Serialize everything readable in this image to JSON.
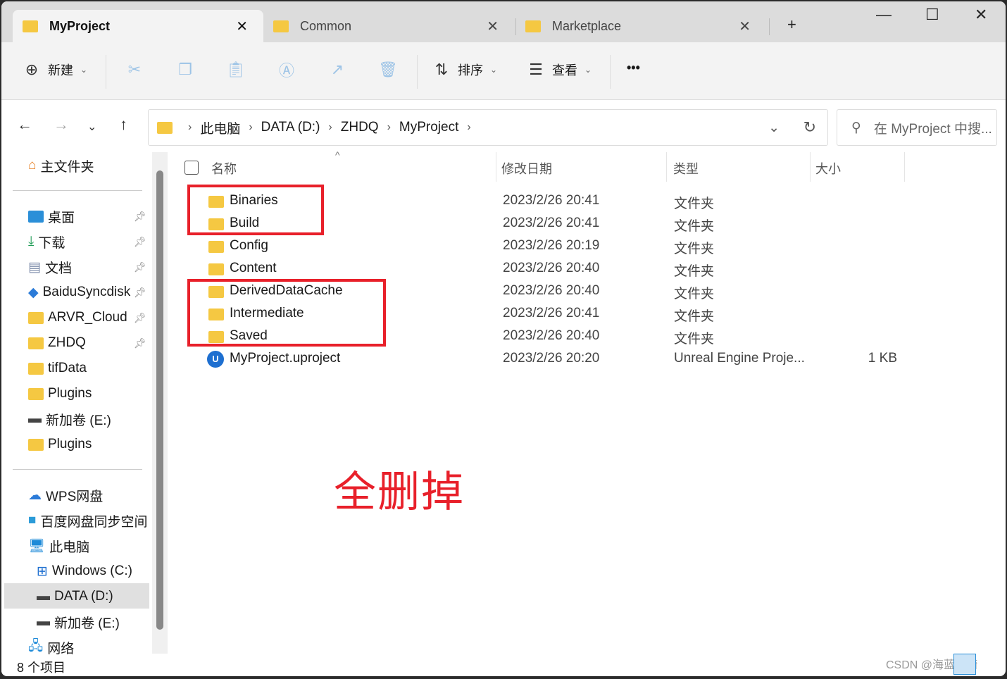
{
  "tabs": [
    {
      "label": "MyProject",
      "active": true
    },
    {
      "label": "Common"
    },
    {
      "label": "Marketplace"
    }
  ],
  "toolbar": {
    "new": "新建",
    "sort": "排序",
    "view": "查看",
    "more": "•••"
  },
  "breadcrumb": [
    "此电脑",
    "DATA (D:)",
    "ZHDQ",
    "MyProject"
  ],
  "search_placeholder": "在 MyProject 中搜...",
  "sidebar": {
    "home": "主文件夹",
    "quick": [
      {
        "label": "桌面",
        "pinned": true
      },
      {
        "label": "下载",
        "pinned": true
      },
      {
        "label": "文档",
        "pinned": true
      },
      {
        "label": "BaiduSyncdisk",
        "pinned": true
      },
      {
        "label": "ARVR_Cloud",
        "pinned": true
      },
      {
        "label": "ZHDQ",
        "pinned": true
      },
      {
        "label": "tifData"
      },
      {
        "label": "Plugins"
      },
      {
        "label": "新加卷 (E:)"
      },
      {
        "label": "Plugins"
      }
    ],
    "places": [
      "WPS网盘",
      "百度网盘同步空间",
      "此电脑",
      "Windows (C:)",
      "DATA (D:)",
      "新加卷 (E:)",
      "网络"
    ]
  },
  "columns": {
    "name": "名称",
    "date": "修改日期",
    "type": "类型",
    "size": "大小"
  },
  "files": [
    {
      "name": "Binaries",
      "date": "2023/2/26 20:41",
      "type": "文件夹",
      "size": ""
    },
    {
      "name": "Build",
      "date": "2023/2/26 20:41",
      "type": "文件夹",
      "size": ""
    },
    {
      "name": "Config",
      "date": "2023/2/26 20:19",
      "type": "文件夹",
      "size": ""
    },
    {
      "name": "Content",
      "date": "2023/2/26 20:40",
      "type": "文件夹",
      "size": ""
    },
    {
      "name": "DerivedDataCache",
      "date": "2023/2/26 20:40",
      "type": "文件夹",
      "size": ""
    },
    {
      "name": "Intermediate",
      "date": "2023/2/26 20:41",
      "type": "文件夹",
      "size": ""
    },
    {
      "name": "Saved",
      "date": "2023/2/26 20:40",
      "type": "文件夹",
      "size": ""
    },
    {
      "name": "MyProject.uproject",
      "date": "2023/2/26 20:20",
      "type": "Unreal Engine Proje...",
      "size": "1 KB"
    }
  ],
  "annotation": "全删掉",
  "status": "8 个项目",
  "watermark": "CSDN @海蓝涟漪",
  "colors": {
    "annotation": "#e8202a",
    "folder": "#f5c842"
  }
}
